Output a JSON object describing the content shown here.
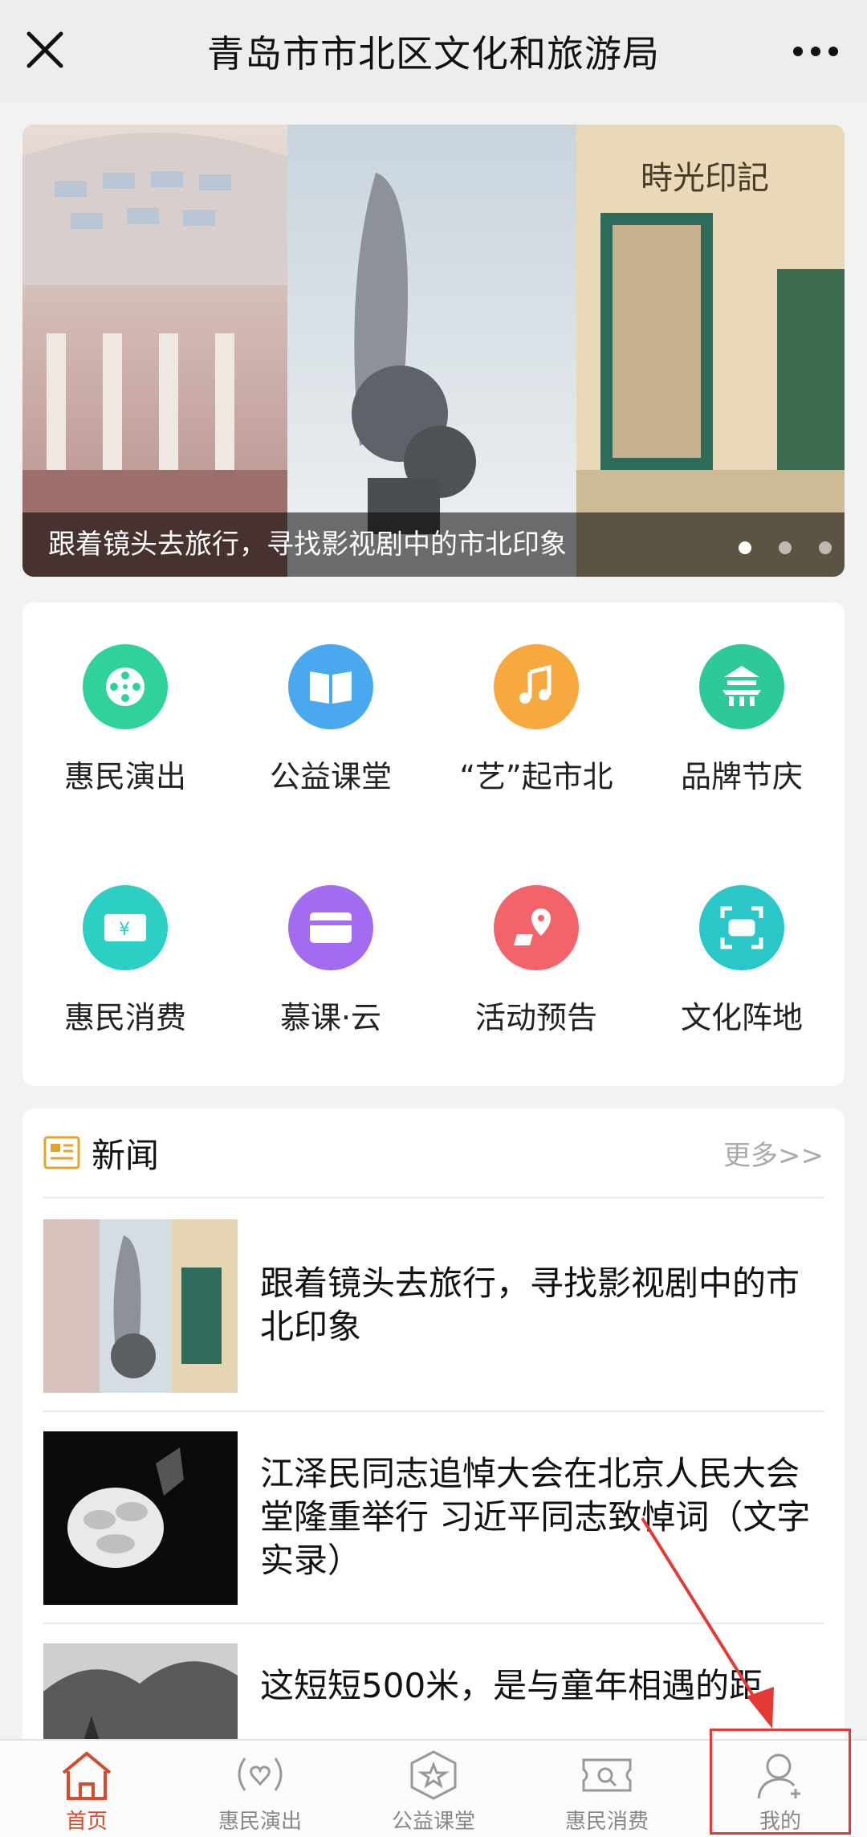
{
  "topbar": {
    "title": "青岛市市北区文化和旅游局"
  },
  "banner": {
    "caption": "跟着镜头去旅行，寻找影视剧中的市北印象",
    "dots": 3,
    "active_dot": 0
  },
  "grid": {
    "items": [
      {
        "label": "惠民演出",
        "icon": "film-reel-icon",
        "color": "#2fd39a"
      },
      {
        "label": "公益课堂",
        "icon": "book-icon",
        "color": "#4aa9ee"
      },
      {
        "label": "“艺”起市北",
        "icon": "music-note-icon",
        "color": "#f7a83e"
      },
      {
        "label": "品牌节庆",
        "icon": "temple-icon",
        "color": "#2ec99a"
      },
      {
        "label": "惠民消费",
        "icon": "ticket-icon",
        "color": "#2bcfc4"
      },
      {
        "label": "慕课·云",
        "icon": "card-icon",
        "color": "#a36bf2"
      },
      {
        "label": "活动预告",
        "icon": "map-pin-icon",
        "color": "#f2636a"
      },
      {
        "label": "文化阵地",
        "icon": "scan-icon",
        "color": "#29c7c7"
      }
    ]
  },
  "news": {
    "title": "新闻",
    "more": "更多>>",
    "items": [
      {
        "title": "跟着镜头去旅行，寻找影视剧中的市北印象"
      },
      {
        "title": "江泽民同志追悼大会在北京人民大会堂隆重举行 习近平同志致悼词（文字实录）"
      },
      {
        "title": "这短短500米，是与童年相遇的距"
      }
    ]
  },
  "tabbar": {
    "tabs": [
      {
        "label": "首页",
        "icon": "home-icon",
        "active": true
      },
      {
        "label": "惠民演出",
        "icon": "broadcast-heart-icon",
        "active": false
      },
      {
        "label": "公益课堂",
        "icon": "star-badge-icon",
        "active": false
      },
      {
        "label": "惠民消费",
        "icon": "coupon-icon",
        "active": false
      },
      {
        "label": "我的",
        "icon": "user-add-icon",
        "active": false
      }
    ]
  },
  "colors": {
    "accent_active": "#d94a2a",
    "annotation_red": "#e53935"
  }
}
